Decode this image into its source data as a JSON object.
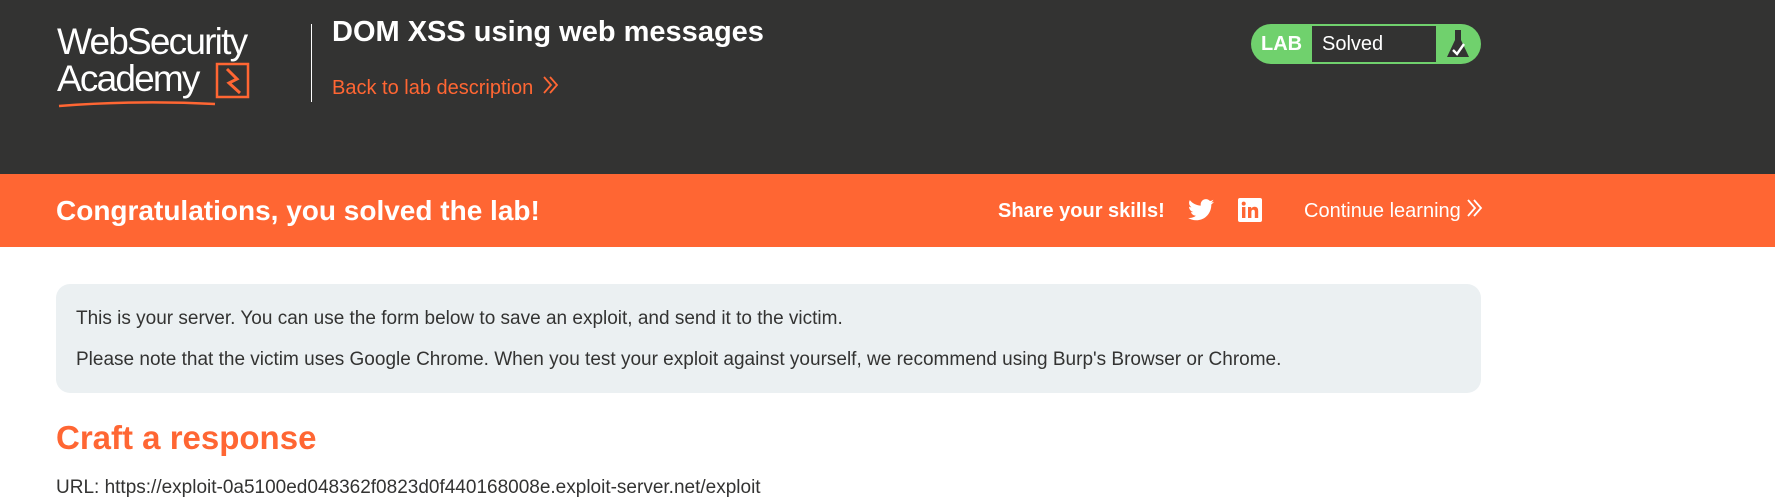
{
  "header": {
    "logo_line1": "WebSecurity",
    "logo_line2": "Academy",
    "lab_title": "DOM XSS using web messages",
    "back_link": "Back to lab description",
    "lab_status": {
      "label": "LAB",
      "status": "Solved"
    }
  },
  "banner": {
    "title": "Congratulations, you solved the lab!",
    "share_label": "Share your skills!",
    "continue_label": "Continue learning"
  },
  "info": {
    "line1": "This is your server. You can use the form below to save an exploit, and send it to the victim.",
    "line2": "Please note that the victim uses Google Chrome. When you test your exploit against yourself, we recommend using Burp's Browser or Chrome."
  },
  "craft": {
    "heading": "Craft a response",
    "url_line": "URL: https://exploit-0a5100ed048362f0823d0f440168008e.exploit-server.net/exploit"
  },
  "colors": {
    "header_bg": "#333332",
    "accent_orange": "#ff6633",
    "lab_green": "#70d16d",
    "info_bg": "#ebf0f2"
  },
  "icons": {
    "back_link": "double-chevron-right-icon",
    "lab_status": "flask-icon",
    "share_twitter": "twitter-icon",
    "share_linkedin": "linkedin-icon",
    "continue": "double-chevron-right-icon"
  }
}
